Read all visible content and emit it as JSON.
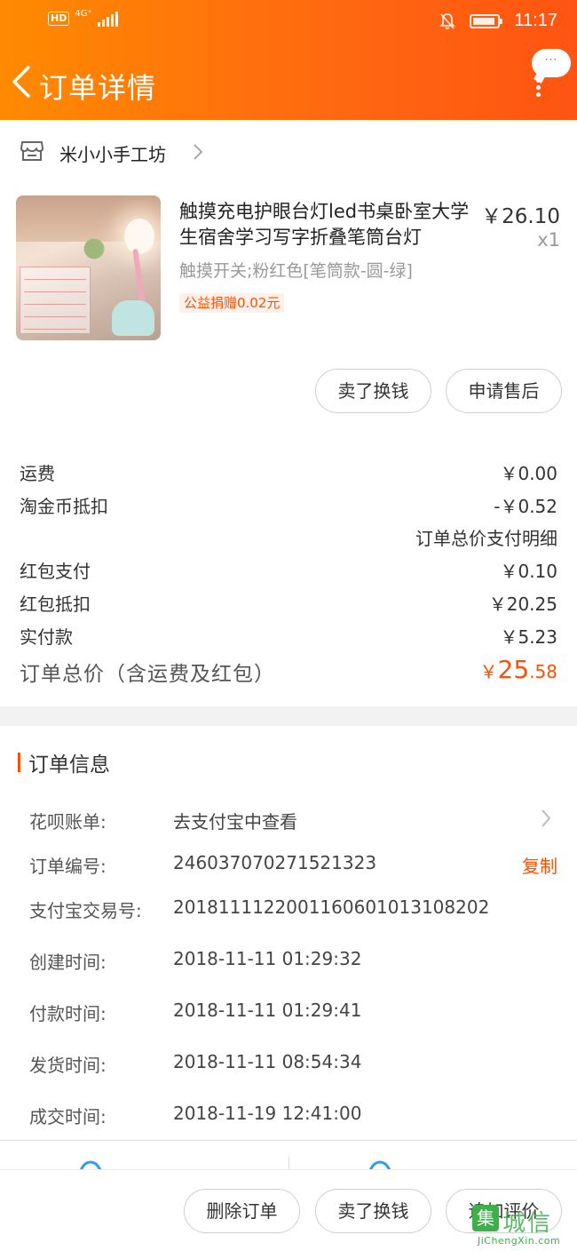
{
  "status_bar": {
    "hd": "HD",
    "network": "4G⁺",
    "time": "11:17"
  },
  "nav": {
    "title": "订单详情",
    "bubble_dots": "···"
  },
  "shop": {
    "name": "米小小手工坊"
  },
  "product": {
    "title": "触摸充电护眼台灯led书桌卧室大学生宿舍学习写字折叠笔筒台灯",
    "price": "￥26.10",
    "qty": "x1",
    "sku": "触摸开关;粉红色[笔筒款-圆-绿]",
    "charity": "公益捐赠0.02元"
  },
  "item_actions": {
    "sell": "卖了换钱",
    "after_sale": "申请售后"
  },
  "fees": [
    {
      "label": "运费",
      "value": "￥0.00"
    },
    {
      "label": "淘金币抵扣",
      "value": "-￥0.52"
    },
    {
      "label": "红包支付",
      "value": "￥0.10"
    },
    {
      "label": "红包抵扣",
      "value": "￥20.25"
    },
    {
      "label": "实付款",
      "value": "￥5.23"
    }
  ],
  "pay_detail_link": "订单总价支付明细",
  "total": {
    "label": "订单总价（含运费及红包）",
    "symbol": "￥",
    "int": "25",
    "dec": ".58"
  },
  "order_info": {
    "title": "订单信息",
    "copy": "复制",
    "rows": [
      {
        "key": "花呗账单:",
        "value": "去支付宝中查看"
      },
      {
        "key": "订单编号:",
        "value": "246037070271521323"
      },
      {
        "key": "支付宝交易号:",
        "value": "2018111122001160601013108202"
      },
      {
        "key": "创建时间:",
        "value": "2018-11-11 01:29:32"
      },
      {
        "key": "付款时间:",
        "value": "2018-11-11 01:29:41"
      },
      {
        "key": "发货时间:",
        "value": "2018-11-11 08:54:34"
      },
      {
        "key": "成交时间:",
        "value": "2018-11-19 12:41:00"
      }
    ]
  },
  "bottom_actions": {
    "delete": "删除订单",
    "sell": "卖了换钱",
    "review": "追加评价"
  },
  "watermark": {
    "logo": "集",
    "text": "城信",
    "url": "JiChengXin.com"
  },
  "colors": {
    "accent": "#ff5000",
    "header_start": "#ff8a00",
    "header_end": "#ff5412",
    "watermark": "#3db04a"
  }
}
